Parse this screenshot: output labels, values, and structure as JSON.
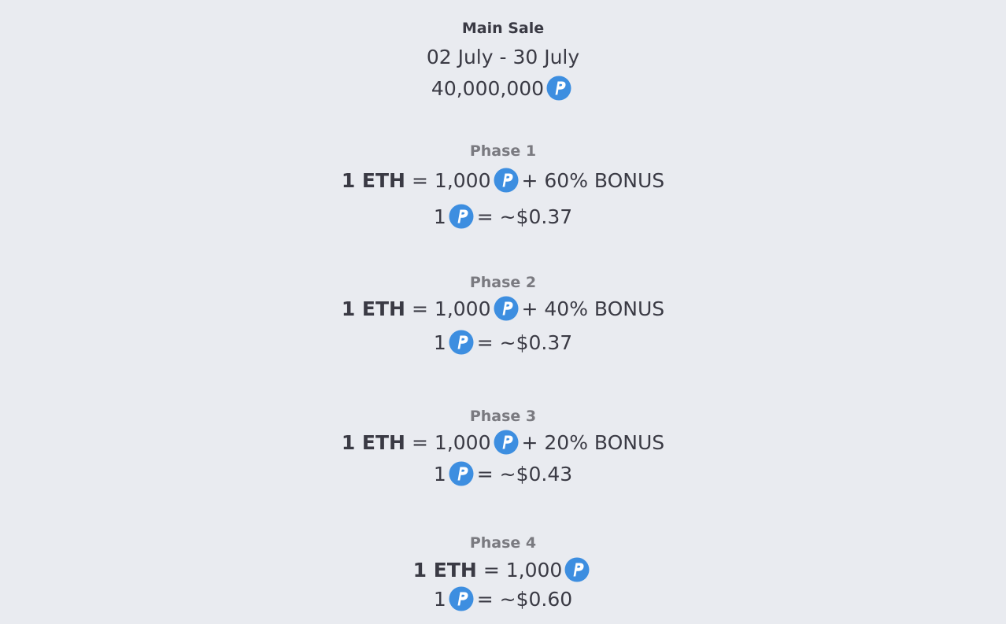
{
  "main_sale": {
    "title": "Main Sale",
    "dates": "02 July - 30 July",
    "supply": "40,000,000"
  },
  "token_icon": "p-coin-icon",
  "colors": {
    "background": "#e9ebf0",
    "token_blue": "#3d8ee0",
    "text": "#3a3a44",
    "phase_title": "#7a7a80"
  },
  "phases": [
    {
      "title": "Phase 1",
      "eth_label": "1 ETH",
      "equals": "=",
      "tokens": "1,000",
      "bonus": "+ 60% BONUS",
      "unit_prefix": "1",
      "price": "= ~$0.37"
    },
    {
      "title": "Phase 2",
      "eth_label": "1 ETH",
      "equals": "=",
      "tokens": "1,000",
      "bonus": "+ 40% BONUS",
      "unit_prefix": "1",
      "price": "= ~$0.37"
    },
    {
      "title": "Phase 3",
      "eth_label": "1 ETH",
      "equals": "=",
      "tokens": "1,000",
      "bonus": "+ 20% BONUS",
      "unit_prefix": "1",
      "price": "= ~$0.43"
    },
    {
      "title": "Phase 4",
      "eth_label": "1 ETH",
      "equals": "=",
      "tokens": "1,000",
      "bonus": "",
      "unit_prefix": "1",
      "price": "= ~$0.60"
    }
  ]
}
